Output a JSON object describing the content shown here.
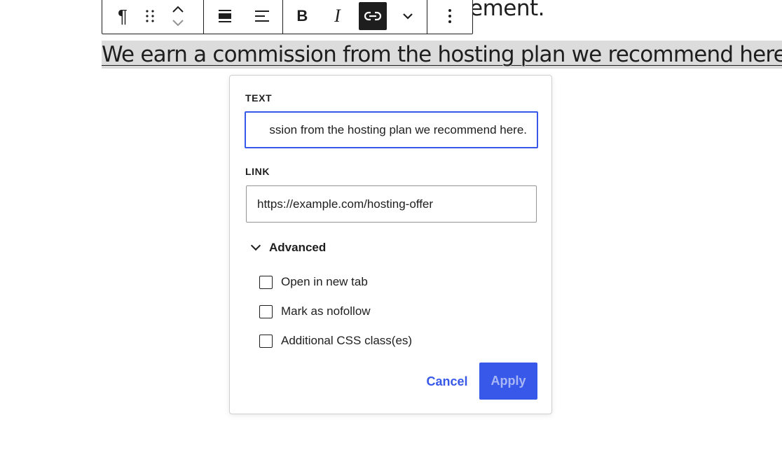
{
  "background": {
    "partial_text": "ement."
  },
  "toolbar": {
    "icons": [
      "paragraph-icon",
      "drag-handle-icon",
      "move-up-icon",
      "move-down-icon",
      "align-center-icon",
      "align-left-icon",
      "bold-icon",
      "italic-icon",
      "link-icon",
      "more-formats-chevron-icon",
      "options-icon"
    ],
    "bold_glyph": "B",
    "italic_glyph": "I",
    "paragraph_glyph": "¶"
  },
  "selected_sentence": "We earn a commission from the hosting plan we recommend here.",
  "link_popover": {
    "text_label": "TEXT",
    "text_value": "ssion from the hosting plan we recommend here.",
    "link_label": "LINK",
    "link_value": "https://example.com/hosting-offer",
    "advanced_label": "Advanced",
    "options": [
      {
        "label": "Open in new tab",
        "checked": false
      },
      {
        "label": "Mark as nofollow",
        "checked": false
      },
      {
        "label": "Additional CSS class(es)",
        "checked": false
      }
    ],
    "cancel_label": "Cancel",
    "apply_label": "Apply"
  },
  "colors": {
    "accent": "#3858e9",
    "apply_text_disabled": "#a9b7f5",
    "selection_bg": "#dcdcdc"
  }
}
